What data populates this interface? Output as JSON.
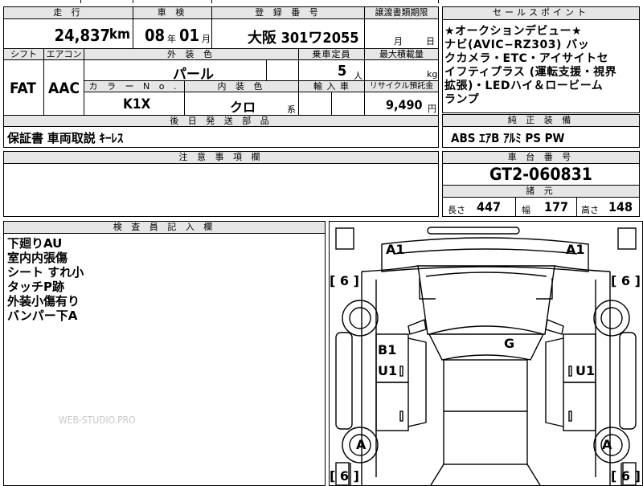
{
  "main_table": {
    "headers": {
      "mileage": "走 行",
      "inspection": "車 検",
      "registration": "登 録 番 号",
      "transfer_deadline": "譲渡書類期限",
      "shift": "シフト",
      "aircon": "エアコン",
      "exterior_color": "外 装 色",
      "capacity": "乗車定員",
      "max_load": "最大積載量",
      "color_no": "カ ラ ー N o .",
      "interior_color": "内 装 色",
      "import": "輸 入 車",
      "recycle": "リサイクル預託金",
      "accessories": "後 日 発 送 部 品"
    },
    "values": {
      "mileage": "24,837",
      "mileage_unit": "km",
      "inspection_year": "08",
      "year_unit": "年",
      "inspection_month": "01",
      "month_unit": "月",
      "registration": "大阪 301ワ2055",
      "transfer_month_unit": "月",
      "transfer_day_unit": "日",
      "shift": "FAT",
      "aircon": "AAC",
      "exterior_color": "パール",
      "capacity": "5",
      "capacity_unit": "人",
      "max_load_unit": "kg",
      "color_no": "K1X",
      "interior_color": "クロ",
      "interior_suffix": "系",
      "recycle": "9,490",
      "recycle_unit": "円",
      "accessories": "保証書 車両取説 ｷｰﾚｽ"
    }
  },
  "sales_points": {
    "header": "セールスポイント",
    "lines": [
      "★オークションデビュー★",
      "ナビ(AVIC−RZ303) バッ",
      "クカメラ・ETC・アイサイトセ",
      "イフティプラス (運転支援・視界",
      "拡張)・LEDハイ＆ロービーム",
      "ランプ"
    ]
  },
  "factory_equipment": {
    "header": "純 正 装 備",
    "value": "ABS ｴｱB ｱﾙﾐ PS PW"
  },
  "notes": {
    "header": "注 意 事 項 欄"
  },
  "chassis": {
    "header": "車 台 番 号",
    "value": "GT2-060831"
  },
  "dimensions": {
    "header": "諸 元",
    "length_label": "長さ",
    "length": "447",
    "width_label": "幅",
    "width": "177",
    "height_label": "高さ",
    "height": "148"
  },
  "inspector": {
    "header": "検 査 員 記 入 欄",
    "remarks": [
      "下廻りAU",
      "室内内張傷",
      "シート すれ小",
      "タッチP跡",
      "外装小傷有り",
      "バンパー下A"
    ]
  },
  "diagram_marks": {
    "front_left": "A1",
    "front_right": "A1",
    "tire_fl": "[ 6 ]",
    "tire_fr": "[ 6 ]",
    "tire_rl": "[ 6 ]",
    "tire_rr": "[ 6 ]",
    "left_door_1": "B1",
    "left_door_2": "U1",
    "right_door": "U1",
    "roof": "G",
    "wheel_left": "A",
    "wheel_right": "A"
  },
  "watermark": "WEB-STUDIO.PRO"
}
